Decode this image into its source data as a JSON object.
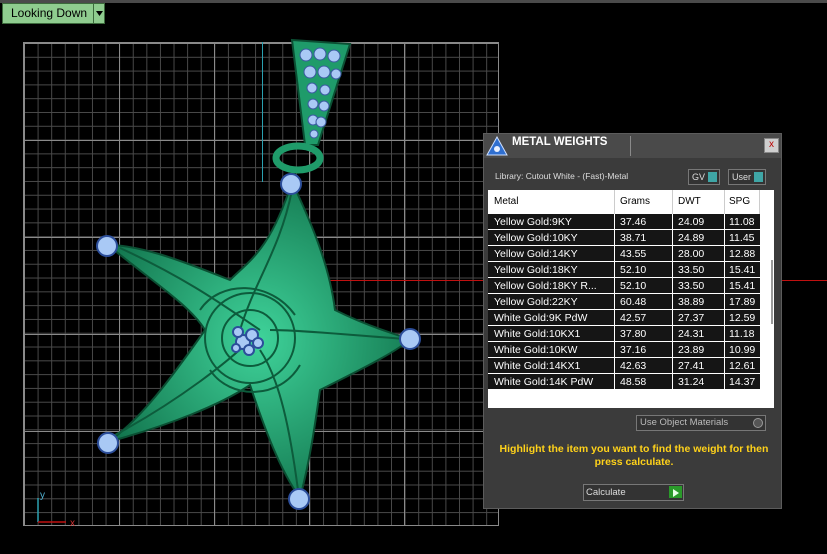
{
  "viewport": {
    "view_label": "Looking Down",
    "axis_labels": {
      "y": "y",
      "x": "x"
    }
  },
  "panel": {
    "title": "METAL WEIGHTS",
    "close_label": "x",
    "library_label": "Library: Cutout White - (Fast)-Metal",
    "gv_label": "GV",
    "user_label": "User",
    "columns": [
      "Metal",
      "Grams",
      "DWT",
      "SPG"
    ],
    "rows": [
      {
        "metal": "Yellow Gold:9KY",
        "grams": "37.46",
        "dwt": "24.09",
        "spg": "11.08"
      },
      {
        "metal": "Yellow Gold:10KY",
        "grams": "38.71",
        "dwt": "24.89",
        "spg": "11.45"
      },
      {
        "metal": "Yellow Gold:14KY",
        "grams": "43.55",
        "dwt": "28.00",
        "spg": "12.88"
      },
      {
        "metal": "Yellow Gold:18KY",
        "grams": "52.10",
        "dwt": "33.50",
        "spg": "15.41"
      },
      {
        "metal": "Yellow Gold:18KY R...",
        "grams": "52.10",
        "dwt": "33.50",
        "spg": "15.41"
      },
      {
        "metal": "Yellow Gold:22KY",
        "grams": "60.48",
        "dwt": "38.89",
        "spg": "17.89"
      },
      {
        "metal": "White Gold:9K PdW",
        "grams": "42.57",
        "dwt": "27.37",
        "spg": "12.59"
      },
      {
        "metal": "White Gold:10KX1",
        "grams": "37.80",
        "dwt": "24.31",
        "spg": "11.18"
      },
      {
        "metal": "White Gold:10KW",
        "grams": "37.16",
        "dwt": "23.89",
        "spg": "10.99"
      },
      {
        "metal": "White Gold:14KX1",
        "grams": "42.63",
        "dwt": "27.41",
        "spg": "12.61"
      },
      {
        "metal": "White Gold:14K PdW",
        "grams": "48.58",
        "dwt": "31.24",
        "spg": "14.37"
      }
    ],
    "use_object_materials_label": "Use Object Materials",
    "hint_text": "Highlight the item you want to find the weight for then press calculate.",
    "calculate_label": "Calculate"
  },
  "colors": {
    "metal_green": "#1f9b6a",
    "gem_blue": "#a9c9f5",
    "hint_yellow": "#ffd21a",
    "grid_line": "#8a8a8a"
  }
}
